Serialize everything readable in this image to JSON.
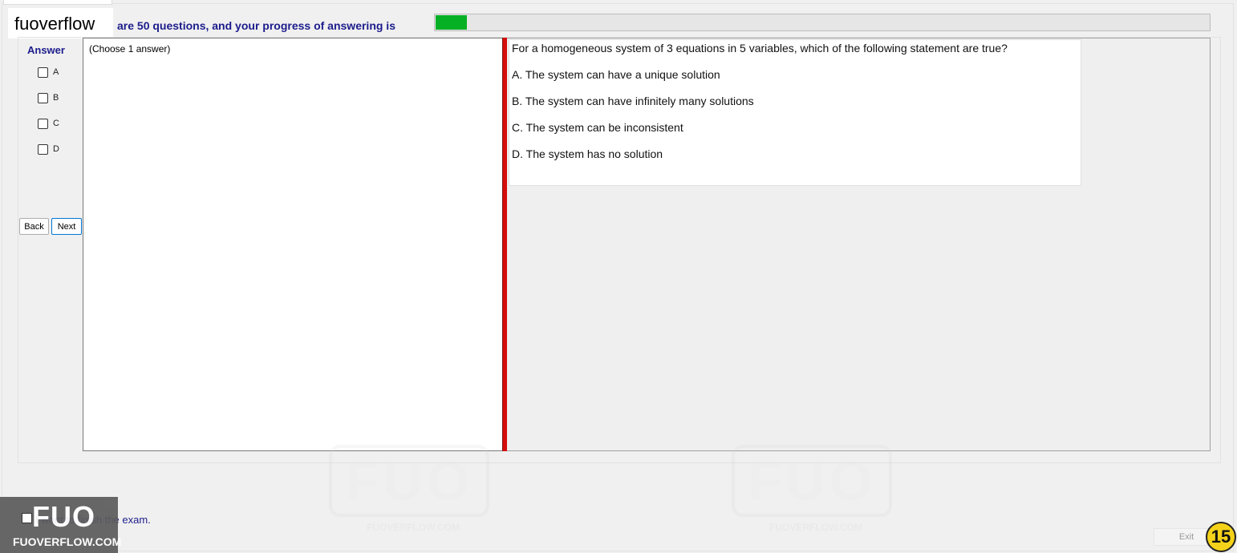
{
  "header": {
    "site_label": "fuoverflow",
    "progress_text": "are 50 questions, and your progress of answering is",
    "progress_fraction": 0.04
  },
  "answer_panel": {
    "title": "Answer",
    "options": [
      "A",
      "B",
      "C",
      "D"
    ],
    "back_label": "Back",
    "next_label": "Next",
    "instruction": "(Choose 1 answer)"
  },
  "question": {
    "text": "For a homogeneous system of 3 equations in 5 variables, which of the following statement are true?",
    "choices": [
      "A.  The system can have a unique solution",
      "B.  The system can have infinitely many solutions",
      "C.  The system can be inconsistent",
      "D.  The system has no solution"
    ]
  },
  "footer": {
    "finish_text": "I want to finish the exam.",
    "exit_label": "Exit",
    "page_badge": "15",
    "logo_big": "FUO",
    "logo_small": "FUOVERFLOW.COM"
  },
  "watermark": {
    "logo": "FUO",
    "sub": "FUOVERFLOW.COM"
  },
  "colors": {
    "accent_text": "#1c1c8c",
    "progress_green": "#06b025",
    "splitter_red": "#d60d0d",
    "badge_yellow": "#f5d21a"
  }
}
